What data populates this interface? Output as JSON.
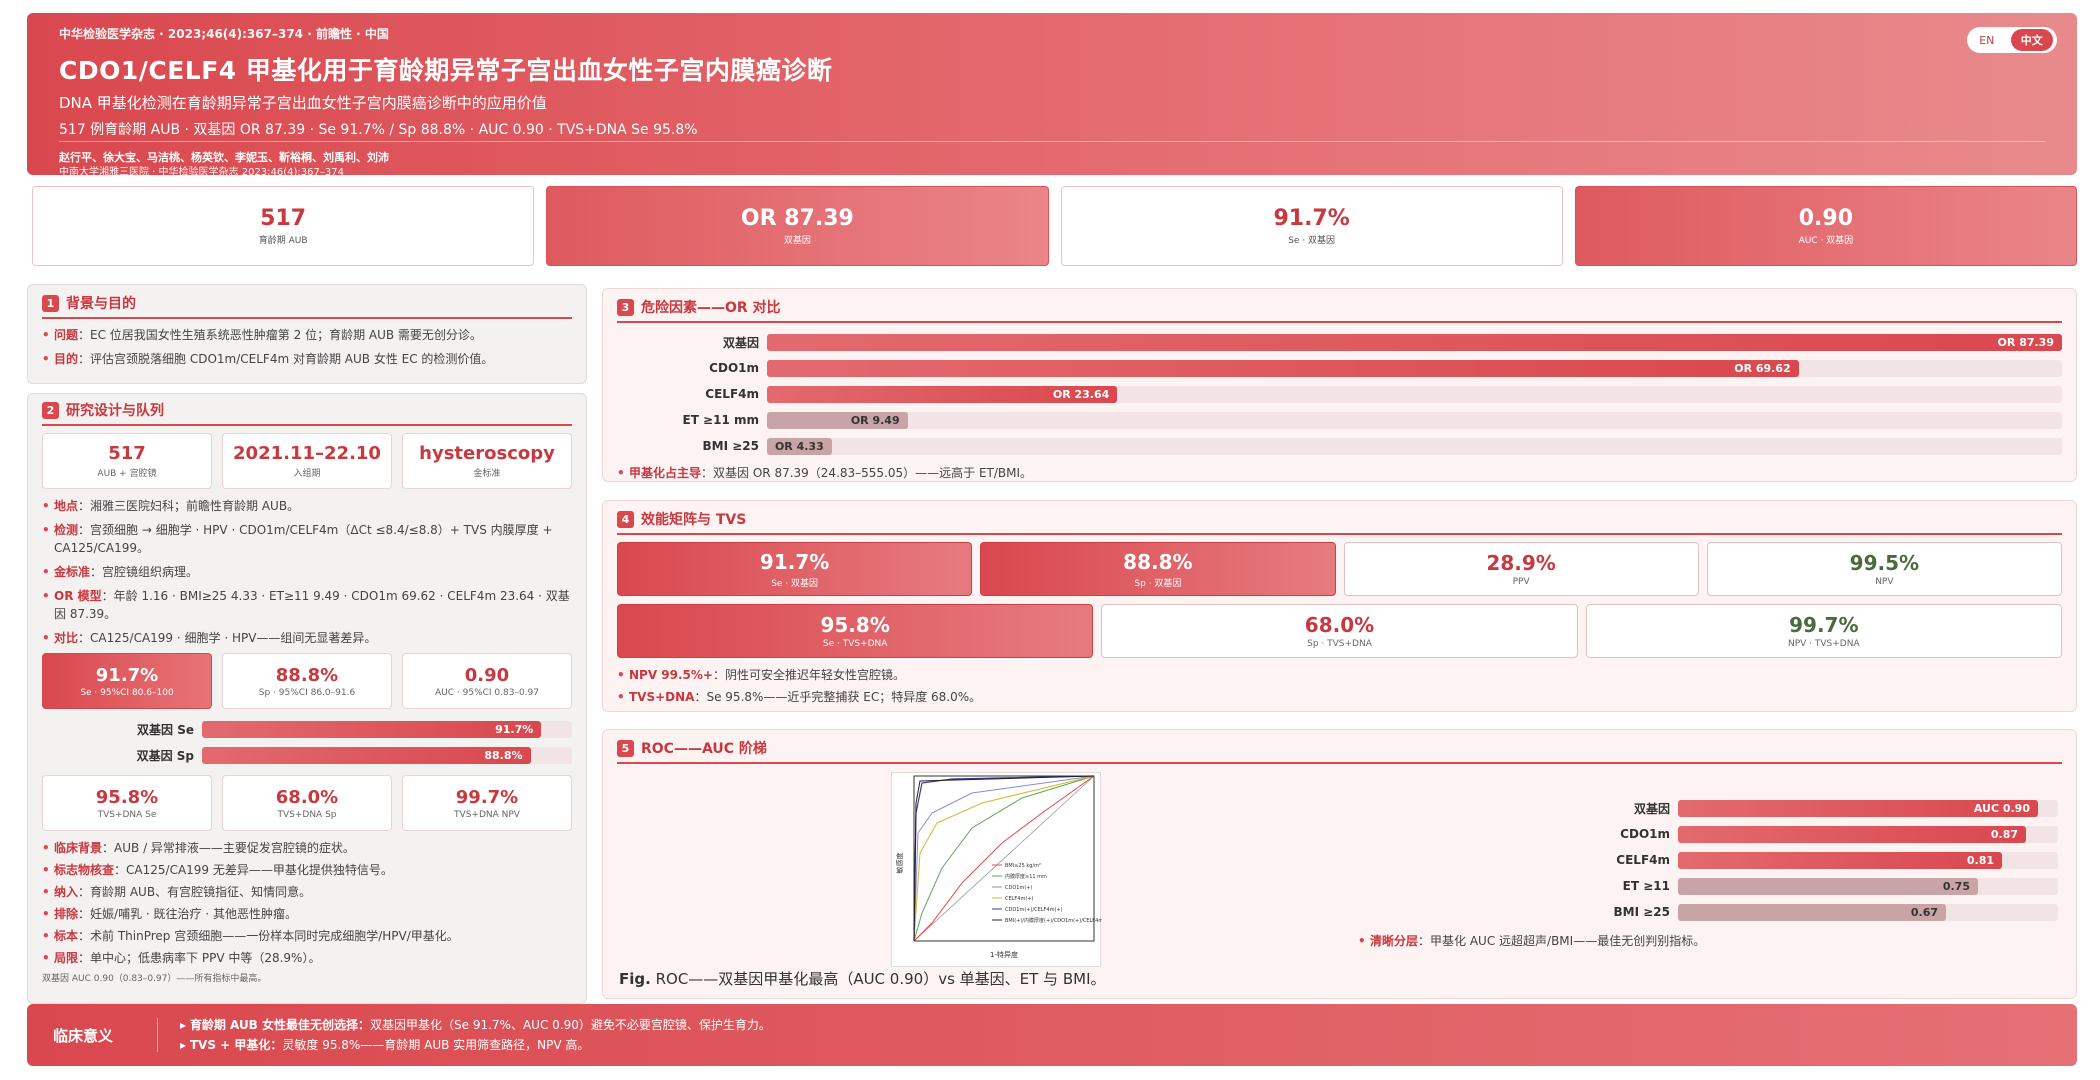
{
  "header": {
    "journal": "中华检验医学杂志 · 2023;46(4):367–374 · 前瞻性 · 中国",
    "title": "CDO1/CELF4 甲基化用于育龄期异常子宫出血女性子宫内膜癌诊断",
    "subtitle": "DNA 甲基化检测在育龄期异常子宫出血女性子宫内膜癌诊断中的应用价值",
    "summary": "517 例育龄期 AUB · 双基因 OR 87.39 · Se 91.7% / Sp 88.8% · AUC 0.90 · TVS+DNA Se 95.8%",
    "authors": "赵行平、徐大宝、马洁桃、杨英钦、李妮玉、靳裕桐、刘禹利、刘沛",
    "affiliation": "中南大学湘雅三医院 · 中华检验医学杂志 2023;46(4):367–374",
    "lang_en": "EN",
    "lang_zh": "中文"
  },
  "kpis": [
    {
      "value": "517",
      "label": "育龄期 AUB"
    },
    {
      "value": "OR 87.39",
      "label": "双基因"
    },
    {
      "value": "91.7%",
      "label": "Se · 双基因"
    },
    {
      "value": "0.90",
      "label": "AUC · 双基因"
    }
  ],
  "s1": {
    "num": "1",
    "title": "背景与目的",
    "b1k": "问题",
    "b1v": "EC 位居我国女性生殖系统恶性肿瘤第 2 位；育龄期 AUB 需要无创分诊。",
    "b2k": "目的",
    "b2v": "评估宫颈脱落细胞 CDO1m/CELF4m 对育龄期 AUB 女性 EC 的检测价值。"
  },
  "s2": {
    "num": "2",
    "title": "研究设计与队列",
    "cards": [
      {
        "value": "517",
        "label": "AUB + 宫腔镜"
      },
      {
        "value": "2021.11–22.10",
        "label": "入组期"
      },
      {
        "value": "hysteroscopy",
        "label": "金标准"
      }
    ],
    "b1k": "地点",
    "b1v": "湘雅三医院妇科；前瞻性育龄期 AUB。",
    "b2k": "检测",
    "b2v": "宫颈细胞 → 细胞学 · HPV · CDO1m/CELF4m（ΔCt ≤8.4/≤8.8）+ TVS 内膜厚度 + CA125/CA199。",
    "b3k": "金标准",
    "b3v": "宫腔镜组织病理。",
    "b4k": "OR 模型",
    "b4v": "年龄 1.16 · BMI≥25 4.33 · ET≥11 9.49 · CDO1m 69.62 · CELF4m 23.64 · 双基因 87.39。",
    "b5k": "对比",
    "b5v": "CA125/CA199 · 细胞学 · HPV——组间无显著差异。",
    "perf": [
      {
        "value": "91.7%",
        "label": "Se · 95%CI 80.6–100"
      },
      {
        "value": "88.8%",
        "label": "Sp · 95%CI 86.0–91.6"
      },
      {
        "value": "0.90",
        "label": "AUC · 95%CI 0.83–0.97"
      }
    ],
    "bars": [
      {
        "label": "双基因 Se",
        "value": 91.7,
        "text": "91.7%"
      },
      {
        "label": "双基因 Sp",
        "value": 88.8,
        "text": "88.8%"
      }
    ],
    "tvs": [
      {
        "value": "95.8%",
        "label": "TVS+DNA Se"
      },
      {
        "value": "68.0%",
        "label": "TVS+DNA Sp"
      },
      {
        "value": "99.7%",
        "label": "TVS+DNA NPV"
      }
    ],
    "c1k": "临床背景",
    "c1v": "AUB / 异常排液——主要促发宫腔镜的症状。",
    "c2k": "标志物核查",
    "c2v": "CA125/CA199 无差异——甲基化提供独特信号。",
    "c3k": "纳入",
    "c3v": "育龄期 AUB、有宫腔镜指征、知情同意。",
    "c4k": "排除",
    "c4v": "妊娠/哺乳 · 既往治疗 · 其他恶性肿瘤。",
    "c5k": "标本",
    "c5v": "术前 ThinPrep 宫颈细胞——一份样本同时完成细胞学/HPV/甲基化。",
    "c6k": "局限",
    "c6v": "单中心；低患病率下 PPV 中等（28.9%）。",
    "footnote": "双基因 AUC 0.90（0.83–0.97）——所有指标中最高。"
  },
  "s3": {
    "num": "3",
    "title": "危险因素——OR 对比",
    "bars": [
      {
        "label": "双基因",
        "value": 87.39,
        "text": "OR 87.39",
        "gray": false
      },
      {
        "label": "CDO1m",
        "value": 69.62,
        "text": "OR 69.62",
        "gray": false
      },
      {
        "label": "CELF4m",
        "value": 23.64,
        "text": "OR 23.64",
        "gray": false
      },
      {
        "label": "ET ≥11 mm",
        "value": 9.49,
        "text": "OR 9.49",
        "gray": true
      },
      {
        "label": "BMI ≥25",
        "value": 4.33,
        "text": "OR 4.33",
        "gray": true
      }
    ],
    "bk": "甲基化占主导",
    "bv": "双基因 OR 87.39（24.83–555.05）——远高于 ET/BMI。"
  },
  "s4": {
    "num": "4",
    "title": "效能矩阵与 TVS",
    "row1": [
      {
        "value": "91.7%",
        "label": "Se · 双基因"
      },
      {
        "value": "88.8%",
        "label": "Sp · 双基因"
      },
      {
        "value": "28.9%",
        "label": "PPV"
      },
      {
        "value": "99.5%",
        "label": "NPV"
      }
    ],
    "row2": [
      {
        "value": "95.8%",
        "label": "Se · TVS+DNA"
      },
      {
        "value": "68.0%",
        "label": "Sp · TVS+DNA"
      },
      {
        "value": "99.7%",
        "label": "NPV · TVS+DNA"
      }
    ],
    "b1k": "NPV 99.5%+",
    "b1v": "阴性可安全推迟年轻女性宫腔镜。",
    "b2k": "TVS+DNA",
    "b2v": "Se 95.8%——近乎完整捕获 EC；特异度 68.0%。"
  },
  "s5": {
    "num": "5",
    "title": "ROC——AUC 阶梯",
    "fig_prefix": "Fig.",
    "fig_caption": "ROC——双基因甲基化最高（AUC 0.90）vs 单基因、ET 与 BMI。",
    "roc_xlabel": "1-特异度",
    "roc_ylabel": "敏感度",
    "roc_legend": [
      "BMI≥25 kg/m²",
      "内膜厚度≥11 mm",
      "CDO1m(+)",
      "CELF4m(+)",
      "CDO1m(+)/CELF4m(+)",
      "BMI(+)/内膜厚度(+)/CDO1m(+)/CELF4m(+)"
    ],
    "bars": [
      {
        "label": "双基因",
        "value": 0.9,
        "text": "AUC 0.90",
        "gray": false
      },
      {
        "label": "CDO1m",
        "value": 0.87,
        "text": "0.87",
        "gray": false
      },
      {
        "label": "CELF4m",
        "value": 0.81,
        "text": "0.81",
        "gray": false
      },
      {
        "label": "ET ≥11",
        "value": 0.75,
        "text": "0.75",
        "gray": true
      },
      {
        "label": "BMI ≥25",
        "value": 0.67,
        "text": "0.67",
        "gray": true
      }
    ],
    "bk": "清晰分层",
    "bv": "甲基化 AUC 远超超声/BMI——最佳无创判别指标。"
  },
  "chart_data": [
    {
      "type": "bar",
      "title": "危险因素——OR 对比",
      "categories": [
        "双基因",
        "CDO1m",
        "CELF4m",
        "ET ≥11 mm",
        "BMI ≥25"
      ],
      "values": [
        87.39,
        69.62,
        23.64,
        9.49,
        4.33
      ]
    },
    {
      "type": "bar",
      "title": "ROC——AUC 阶梯",
      "categories": [
        "双基因",
        "CDO1m",
        "CELF4m",
        "ET ≥11",
        "BMI ≥25"
      ],
      "values": [
        0.9,
        0.87,
        0.81,
        0.75,
        0.67
      ]
    }
  ],
  "footer": {
    "title": "临床意义",
    "l1k": "育龄期 AUB 女性最佳无创选择：",
    "l1v": "双基因甲基化（Se 91.7%、AUC 0.90）避免不必要宫腔镜、保护生育力。",
    "l2k": "TVS + 甲基化：",
    "l2v": "灵敏度 95.8%——育龄期 AUB 实用筛查路径，NPV 高。"
  },
  "colors": {
    "accent": "#d9484e",
    "accent_dark": "#c8383f",
    "muted_bar": "#c9a4a6"
  }
}
